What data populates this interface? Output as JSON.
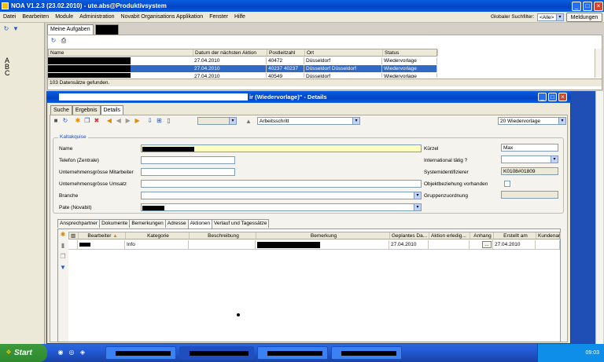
{
  "window": {
    "title": "NOA V1.2.3 (23.02.2010) - ute.abs@Produktivsystem"
  },
  "menu": [
    "Datei",
    "Bearbeiten",
    "Module",
    "Administration",
    "Novabit Organisations Applikation",
    "Fenster",
    "Hilfe"
  ],
  "global_search": {
    "label": "Globaler Suchfilter:",
    "value": "<Alle>",
    "button": "Meldungen"
  },
  "top_tabs": {
    "active": "Meine Aufgaben"
  },
  "tasks_grid": {
    "columns": [
      "Name",
      "Datum der nächsten Aktion",
      "Postleitzahl",
      "Ort",
      "Status"
    ],
    "rows": [
      [
        "27.04.2010",
        "40472",
        "Düsseldorf",
        "Wiedervorlage"
      ],
      [
        "27.04.2010",
        "40237 40237",
        "Düsseldorf Düsseldorf",
        "Wiedervorlage"
      ],
      [
        "27.04.2010",
        "40549",
        "Düsseldorf",
        "Wiedervorlage"
      ]
    ],
    "status": "103 Datensätze gefunden."
  },
  "dialog": {
    "title_suffix": "ir (Wiedervorlage)\" - Details",
    "tabs": [
      "Suche",
      "Ergebnis",
      "Details"
    ],
    "toolbar": {
      "step": "Arbeitsschritt",
      "template": "20 Wiedervorlage"
    },
    "group_title": "Kaltakquise",
    "fields": {
      "name": "Name",
      "phone": "Telefon (Zentrale)",
      "size": "Unternehmensgrösse Mitarbeiter",
      "revenue": "Unternehmensgrösse Umsatz",
      "branch": "Branche",
      "pate": "Pate (Novabit)",
      "kuerzel": "Kürzel",
      "kuerzel_value": "Max",
      "international": "International tätig ?",
      "sysid": "Systemidentifizierer",
      "sysid_value": "K0108#01809",
      "objekt": "Objektbeziehung vorhanden",
      "gruppen": "Gruppenzuordnung"
    },
    "lower_tabs": [
      "Ansprechpartner",
      "Dokumente",
      "Bemerkungen",
      "Adresse",
      "Aktionen",
      "Verlauf und Tagessätze"
    ],
    "actions_grid": {
      "columns": [
        "Bearbeiter",
        "Kategorie",
        "Beschreibung",
        "Bemerkung",
        "Geplantes Da...",
        "Aktion erledig...",
        "Anhang",
        "Erstellt am",
        "Kundenan"
      ],
      "row": {
        "category": "Info",
        "planned": "27.04.2010",
        "attach": "...",
        "created": "27.04.2010"
      }
    }
  },
  "taskbar": {
    "start": "Start",
    "clock": "09:03"
  }
}
